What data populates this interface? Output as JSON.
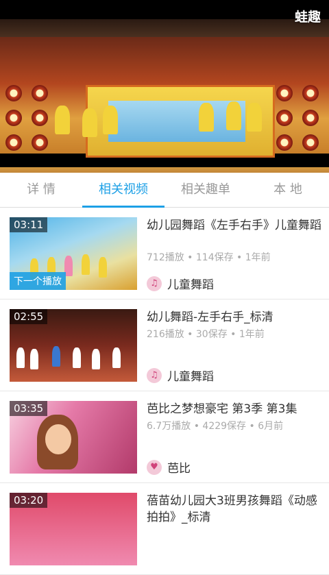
{
  "player": {
    "watermark": "蛙趣"
  },
  "tabs": [
    {
      "label": "详 情",
      "active": false
    },
    {
      "label": "相关视频",
      "active": true
    },
    {
      "label": "相关趣单",
      "active": false
    },
    {
      "label": "本 地",
      "active": false
    }
  ],
  "videos": [
    {
      "duration": "03:11",
      "badge": "下一个播放",
      "title": "幼儿园舞蹈《左手右手》儿童舞蹈",
      "meta": "712播放 • 114保存 • 1年前",
      "channel": "儿童舞蹈"
    },
    {
      "duration": "02:55",
      "badge": "",
      "title": "幼儿舞蹈-左手右手_标清",
      "meta": "216播放 • 30保存 • 1年前",
      "channel": "儿童舞蹈"
    },
    {
      "duration": "03:35",
      "badge": "",
      "title": "芭比之梦想豪宅 第3季 第3集",
      "meta": "6.7万播放 • 4229保存 • 6月前",
      "channel": "芭比"
    },
    {
      "duration": "03:20",
      "badge": "",
      "title": "蓓苗幼儿园大3班男孩舞蹈《动感拍拍》_标清",
      "meta": "",
      "channel": ""
    }
  ],
  "colors": {
    "accent": "#1da0e6"
  }
}
